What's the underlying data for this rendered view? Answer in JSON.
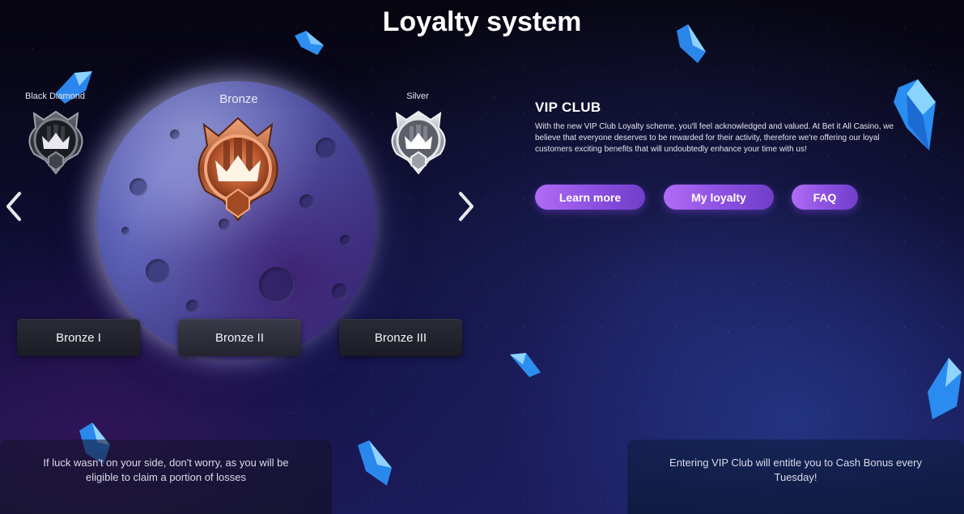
{
  "header": {
    "title": "Loyalty system"
  },
  "carousel": {
    "prev_tier": "Black Diamond",
    "current_tier": "Bronze",
    "next_tier": "Silver",
    "levels": [
      {
        "label": "Bronze I",
        "active": false
      },
      {
        "label": "Bronze II",
        "active": true
      },
      {
        "label": "Bronze III",
        "active": false
      }
    ]
  },
  "vip": {
    "heading": "VIP CLUB",
    "description": "With the new VIP Club Loyalty scheme, you'll feel acknowledged and valued. At Bet it All Casino, we believe that everyone deserves to be rewarded for their activity, therefore we're offering our loyal customers exciting benefits that will undoubtedly enhance your time with us!",
    "buttons": {
      "learn_more": "Learn more",
      "my_loyalty": "My loyalty",
      "faq": "FAQ"
    }
  },
  "bottom": {
    "left_text": "If luck wasn't on your side, don't worry, as you will be eligible to claim a portion of losses",
    "right_text": "Entering VIP Club will entitle you to Cash Bonus every Tuesday!"
  },
  "colors": {
    "accent_purple": "#9a5ceb",
    "bronze": "#c4663a",
    "silver": "#c9ccd4",
    "crystal_blue": "#3aa8ff"
  },
  "icons": {
    "prev": "chevron-left-icon",
    "next": "chevron-right-icon",
    "badge_prev": "black-diamond-badge-icon",
    "badge_current": "bronze-badge-icon",
    "badge_next": "silver-badge-icon"
  }
}
